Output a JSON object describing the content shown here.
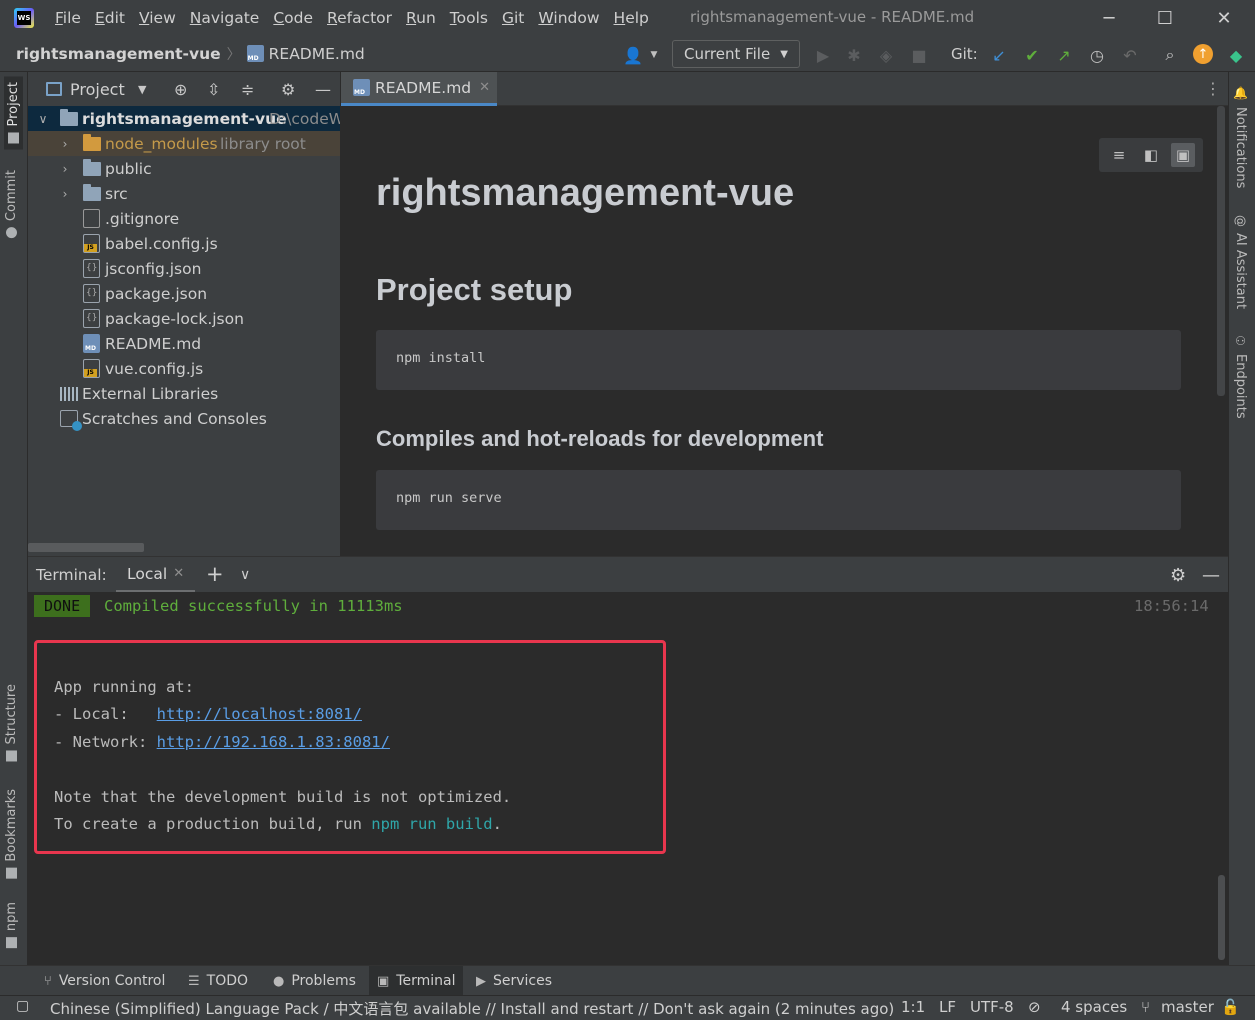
{
  "menu": [
    "File",
    "Edit",
    "View",
    "Navigate",
    "Code",
    "Refactor",
    "Run",
    "Tools",
    "Git",
    "Window",
    "Help"
  ],
  "window_title": "rightsmanagement-vue - README.md",
  "breadcrumb": {
    "project": "rightsmanagement-vue",
    "file": "README.md"
  },
  "toolbar": {
    "run_config": "Current File",
    "git_label": "Git:"
  },
  "project_panel": {
    "title": "Project",
    "tree": [
      {
        "name": "rightsmanagement-vue",
        "extra": "D:\\codeW",
        "type": "root"
      },
      {
        "name": "node_modules",
        "extra": "library root",
        "type": "folder-excluded"
      },
      {
        "name": "public",
        "type": "folder"
      },
      {
        "name": "src",
        "type": "folder"
      },
      {
        "name": ".gitignore",
        "type": "git"
      },
      {
        "name": "babel.config.js",
        "type": "js"
      },
      {
        "name": "jsconfig.json",
        "type": "json"
      },
      {
        "name": "package.json",
        "type": "json"
      },
      {
        "name": "package-lock.json",
        "type": "json"
      },
      {
        "name": "README.md",
        "type": "md"
      },
      {
        "name": "vue.config.js",
        "type": "js"
      },
      {
        "name": "External Libraries",
        "type": "lib"
      },
      {
        "name": "Scratches and Consoles",
        "type": "scratch"
      }
    ]
  },
  "editor": {
    "tab_label": "README.md",
    "h1": "rightsmanagement-vue",
    "h2": "Project setup",
    "code1": "npm install",
    "h3": "Compiles and hot-reloads for development",
    "code2": "npm run serve"
  },
  "left_stripe": [
    "Project",
    "Commit",
    "Structure",
    "Bookmarks",
    "npm"
  ],
  "right_stripe": [
    "Notifications",
    "AI Assistant",
    "Endpoints"
  ],
  "terminal": {
    "label": "Terminal:",
    "tab": "Local",
    "done": "DONE",
    "compiled": "Compiled successfully in 11113ms",
    "timestamp": "18:56:14",
    "app_running": "App running at:",
    "local_prefix": "- Local:   ",
    "local_url": "http://localhost:8081/",
    "network_prefix": "- Network: ",
    "network_url": "http://192.168.1.83:8081/",
    "note": "Note that the development build is not optimized.",
    "create_prefix": "To create a production build, run ",
    "create_cmd": "npm run build",
    "create_suffix": "."
  },
  "tool_tabs": [
    "Version Control",
    "TODO",
    "Problems",
    "Terminal",
    "Services"
  ],
  "status": {
    "message": "Chinese (Simplified) Language Pack / 中文语言包 available // Install and restart // Don't ask again (2 minutes ago)",
    "position": "1:1",
    "line_sep": "LF",
    "encoding": "UTF-8",
    "indent": "4 spaces",
    "branch": "master"
  },
  "colors": {
    "accent": "#4a88c7",
    "highlight_box": "#e8364e",
    "done_bg": "#3d6f1d",
    "success_text": "#5fae3c",
    "link": "#5a9ee6"
  }
}
